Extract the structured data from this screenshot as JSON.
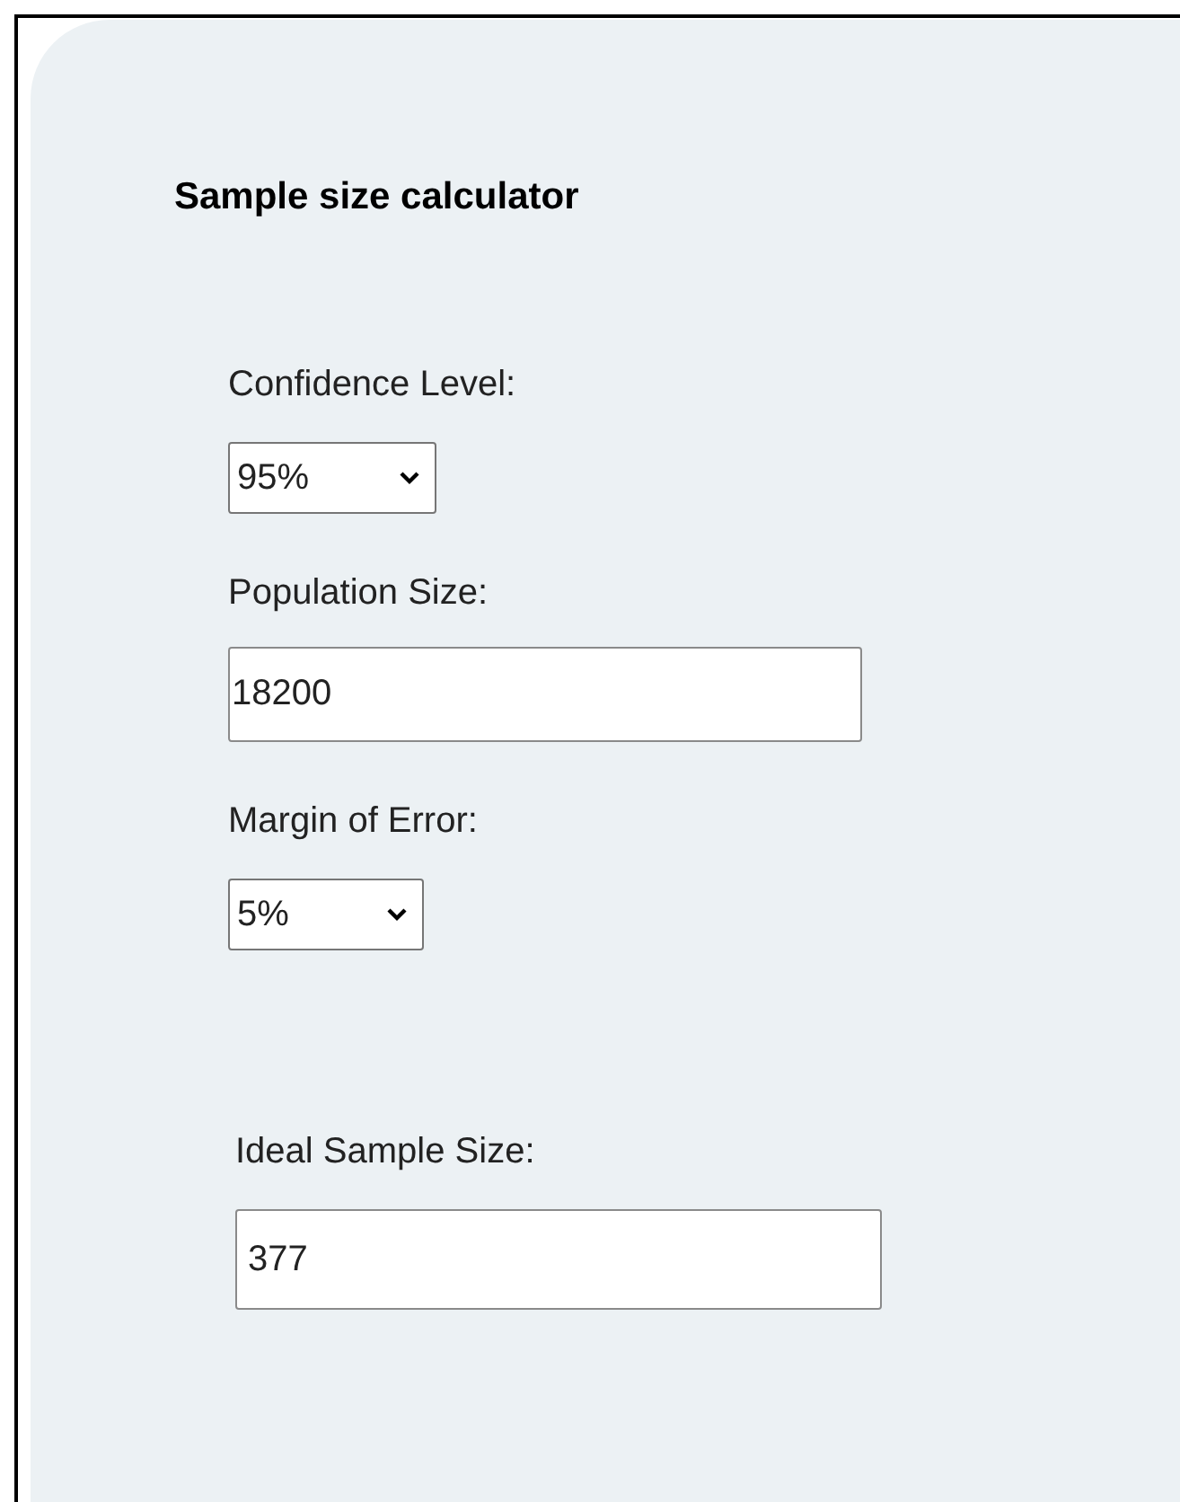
{
  "title": "Sample size calculator",
  "fields": [
    {
      "label": "Confidence Level:",
      "kind": "select",
      "value": "95%"
    },
    {
      "label": "Population Size:",
      "kind": "input",
      "value": "18200"
    },
    {
      "label": "Margin of Error:",
      "kind": "select",
      "value": "5%"
    },
    {
      "label": "Ideal Sample Size:",
      "kind": "result",
      "value": "377"
    }
  ]
}
